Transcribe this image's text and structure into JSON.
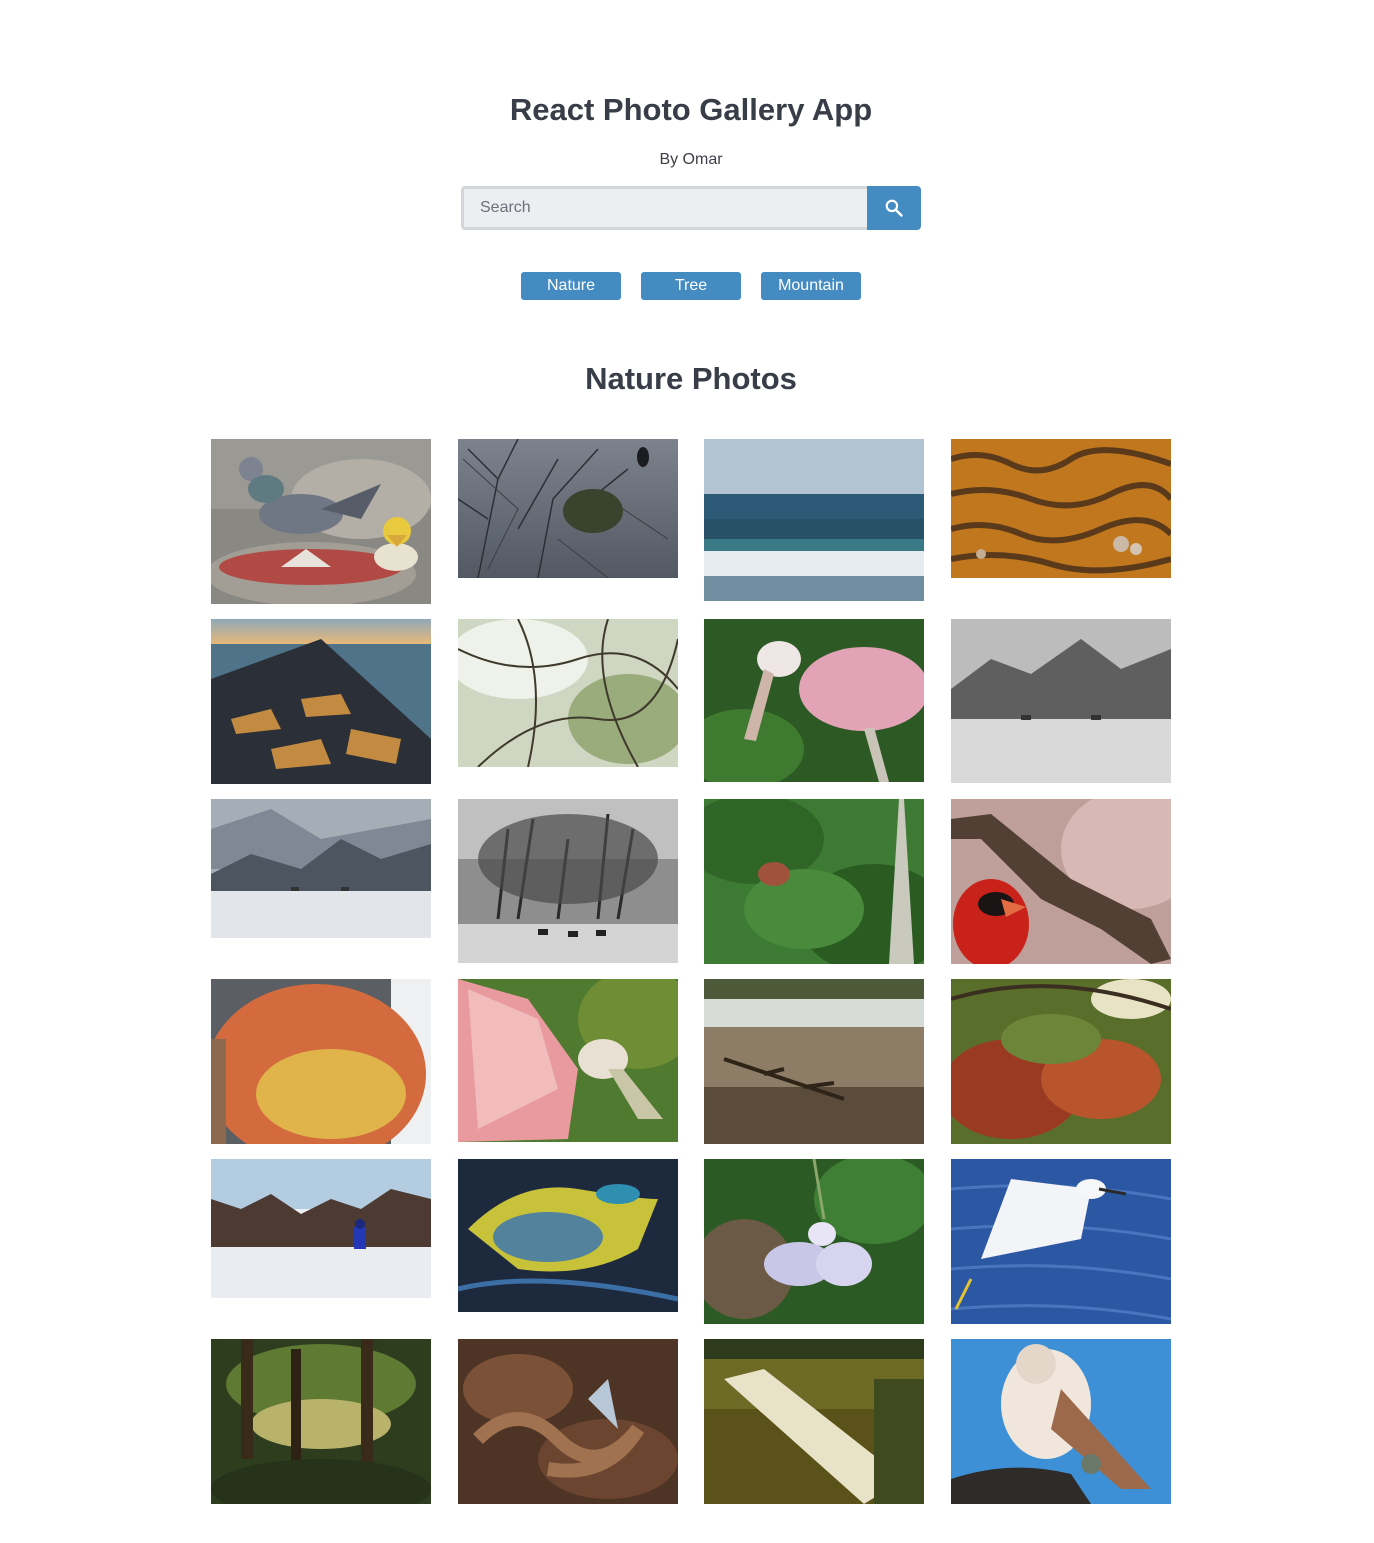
{
  "header": {
    "title": "React Photo Gallery App",
    "byline": "By Omar"
  },
  "search": {
    "placeholder": "Search",
    "value": "",
    "button_icon": "search-icon",
    "accent_color": "#438bc1"
  },
  "nav": {
    "buttons": [
      {
        "label": "Nature"
      },
      {
        "label": "Tree"
      },
      {
        "label": "Mountain"
      }
    ]
  },
  "gallery": {
    "heading": "Nature Photos",
    "photos": [
      {
        "subject": "pigeon-on-birdbath"
      },
      {
        "subject": "bird-on-bare-tree"
      },
      {
        "subject": "ocean-waves"
      },
      {
        "subject": "sand-ripples"
      },
      {
        "subject": "rock-jetty-sunset"
      },
      {
        "subject": "tree-branches"
      },
      {
        "subject": "roseate-spoonbill"
      },
      {
        "subject": "foggy-field-horses"
      },
      {
        "subject": "snowy-foggy-field"
      },
      {
        "subject": "foggy-trees-horses"
      },
      {
        "subject": "cardinal-in-tree"
      },
      {
        "subject": "cardinal-on-branch"
      },
      {
        "subject": "apple-closeup"
      },
      {
        "subject": "spoonbill-wings"
      },
      {
        "subject": "stream-with-driftwood"
      },
      {
        "subject": "autumn-leaves"
      },
      {
        "subject": "snowy-walk"
      },
      {
        "subject": "aerial-volcanic-lakes"
      },
      {
        "subject": "white-violet-flower"
      },
      {
        "subject": "egret-over-water"
      },
      {
        "subject": "forest-pond"
      },
      {
        "subject": "camouflaged-snake"
      },
      {
        "subject": "river-weir"
      },
      {
        "subject": "kestrel-perched"
      }
    ]
  }
}
